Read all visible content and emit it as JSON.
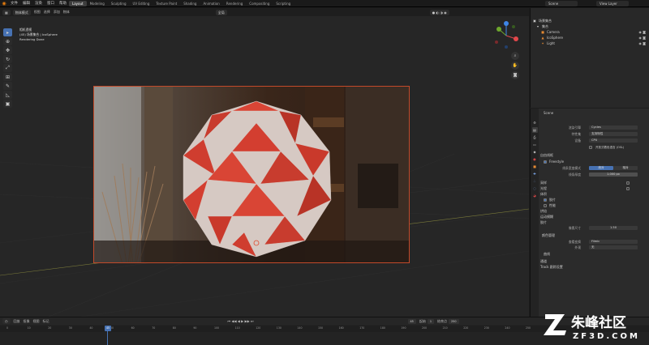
{
  "topbar": {
    "menus": [
      "文件",
      "编辑",
      "渲染",
      "窗口",
      "帮助"
    ],
    "workspaces": [
      "Layout",
      "Modeling",
      "Sculpting",
      "UV Editing",
      "Texture Paint",
      "Shading",
      "Animation",
      "Rendering",
      "Compositing",
      "Scripting"
    ],
    "active_workspace": "Layout",
    "scene": "Scene",
    "view_layer": "View Layer"
  },
  "viewport": {
    "header": {
      "mode": "物体模式",
      "view": "视图",
      "select": "选择",
      "add": "添加",
      "object": "物体",
      "transform": "全局"
    },
    "render_info": {
      "line1": "相机透视",
      "line2": "(45) 场景集合 | IcoSphere",
      "line3": "Rendering Done"
    },
    "tools": [
      "select-icon",
      "cursor-icon",
      "move-icon",
      "rotate-icon",
      "scale-icon",
      "transform-icon",
      "annotate-icon",
      "measure-icon",
      "add-cube-icon"
    ],
    "gizmo_colors": {
      "x": "#e2474b",
      "y": "#6ea72d",
      "z": "#3f86e8"
    }
  },
  "outliner": {
    "root": "场景集合",
    "items": [
      {
        "name": "集合",
        "icon": "collection-icon"
      },
      {
        "name": "Camera",
        "icon": "camera-icon"
      },
      {
        "name": "IcoSphere",
        "icon": "mesh-icon"
      },
      {
        "name": "Light",
        "icon": "light-icon"
      }
    ]
  },
  "properties": {
    "scene": "Scene",
    "render_engine_label": "渲染引擎",
    "render_engine": "Cycles",
    "feature_set_label": "特性集",
    "feature_set": "支持特性",
    "device_label": "设备",
    "device": "CPU",
    "osl": "开放式着色语言 (OSL)",
    "freestyle_section": "自由线框",
    "freestyle": "Freestyle",
    "line_mode_label": "线条宽度模式",
    "line_mode_a": "绝对",
    "line_mode_b": "相对",
    "line_thickness_label": "线条厚度",
    "line_thickness": "1.000 px",
    "sections": [
      "采样",
      "光程",
      "体积",
      "胶片",
      "性能",
      "烘焙",
      "颜色管理",
      "运动模糊",
      "胶片"
    ],
    "motion_blur": "运动模糊",
    "film_sub": "像素尺寸",
    "film_value": "1.50",
    "color_mgmt": "颜色管理",
    "view_transform_label": "查看变换",
    "view_transform": "Filmic",
    "look_label": "外观",
    "look": "无",
    "exposure_label": "曝光度",
    "exposure": "0.000",
    "gamma_label": "伽玛",
    "gamma": "1.000",
    "curves": "曲线",
    "bottom_sections": [
      "通道",
      "Track 跟踪设置"
    ]
  },
  "timeline": {
    "menus": [
      "回放",
      "抠像",
      "视图",
      "标记"
    ],
    "current_frame": "45",
    "start_label": "起始",
    "start": "1",
    "end_label": "结束点",
    "end": "250",
    "frames": [
      0,
      10,
      20,
      30,
      40,
      50,
      60,
      70,
      80,
      90,
      100,
      110,
      120,
      130,
      140,
      150,
      160,
      170,
      180,
      190,
      200,
      210,
      220,
      230,
      240,
      250
    ]
  },
  "watermark": {
    "name": "朱峰社区",
    "url": "ZF3D.COM"
  }
}
